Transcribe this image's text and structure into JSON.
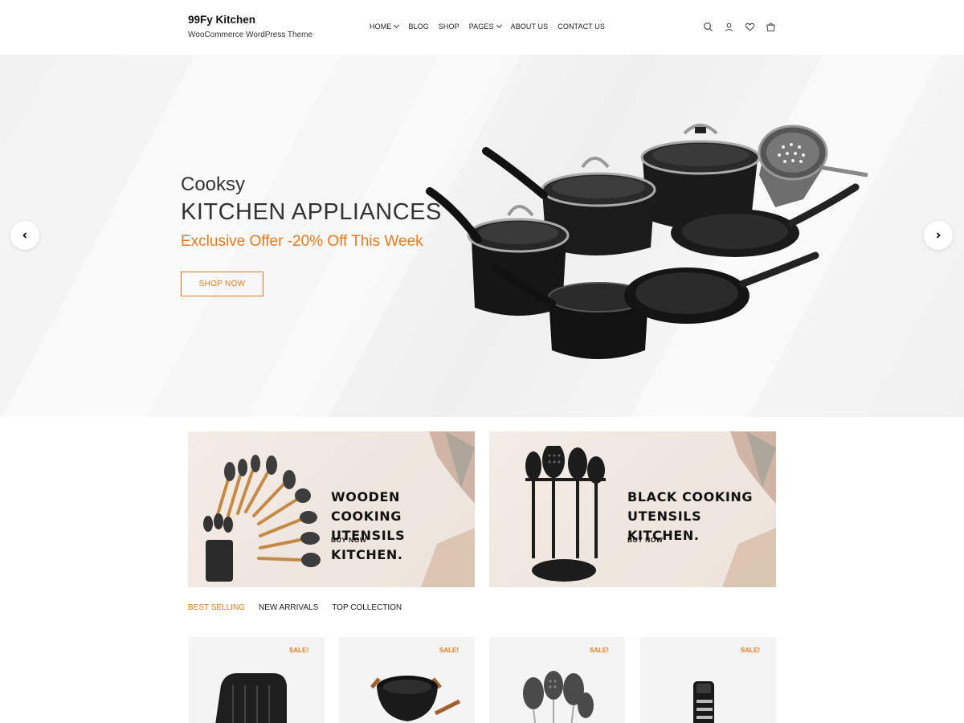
{
  "header": {
    "site_title": "99Fy Kitchen",
    "tagline": "WooCommerce WordPress Theme",
    "nav": [
      {
        "label": "HOME",
        "has_dropdown": true
      },
      {
        "label": "BLOG",
        "has_dropdown": false
      },
      {
        "label": "SHOP",
        "has_dropdown": false
      },
      {
        "label": "PAGES",
        "has_dropdown": true
      },
      {
        "label": "ABOUT US",
        "has_dropdown": false
      },
      {
        "label": "CONTACT US",
        "has_dropdown": false
      }
    ],
    "icons": [
      "search-icon",
      "user-icon",
      "heart-icon",
      "cart-icon"
    ]
  },
  "hero": {
    "brand": "Cooksy",
    "title": "KITCHEN APPLIANCES",
    "offer": "Exclusive Offer -20% Off This Week",
    "button": "SHOP NOW",
    "accent_color": "#e67a1e"
  },
  "banners": [
    {
      "title_line1": "WOODEN COOKING",
      "title_line2": "UTENSILS KITCHEN.",
      "cta": "BUY NOW"
    },
    {
      "title_line1": "BLACK COOKING",
      "title_line2": "UTENSILS KITCHEN.",
      "cta": "BUY NOW"
    }
  ],
  "tabs": [
    {
      "label": "BEST SELLING",
      "active": true
    },
    {
      "label": "NEW ARRIVALS",
      "active": false
    },
    {
      "label": "TOP COLLECTION",
      "active": false
    }
  ],
  "products": [
    {
      "badge": "SALE!",
      "image": "grill-pan"
    },
    {
      "badge": "SALE!",
      "image": "wok"
    },
    {
      "badge": "SALE!",
      "image": "utensil-set"
    },
    {
      "badge": "SALE!",
      "image": "can-opener"
    }
  ]
}
